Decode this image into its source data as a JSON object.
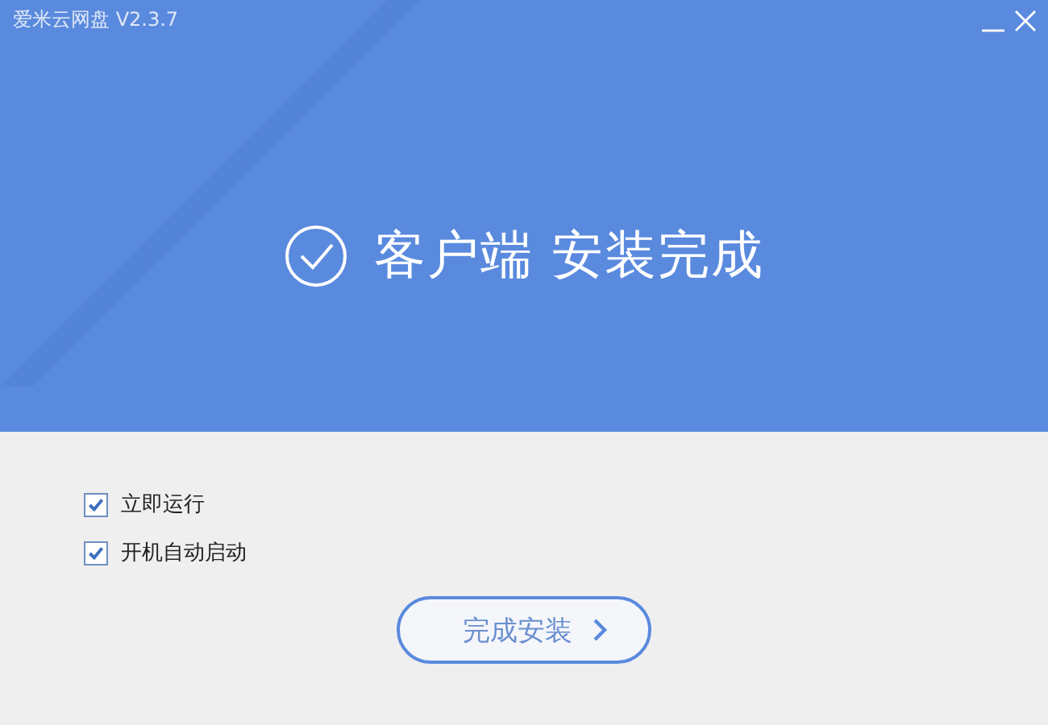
{
  "window": {
    "title": "爱米云网盘 V2.3.7"
  },
  "headline": "客户端 安装完成",
  "options": [
    {
      "label": "立即运行",
      "checked": true
    },
    {
      "label": "开机自动启动",
      "checked": true
    }
  ],
  "finish_button": {
    "label": "完成安装"
  }
}
